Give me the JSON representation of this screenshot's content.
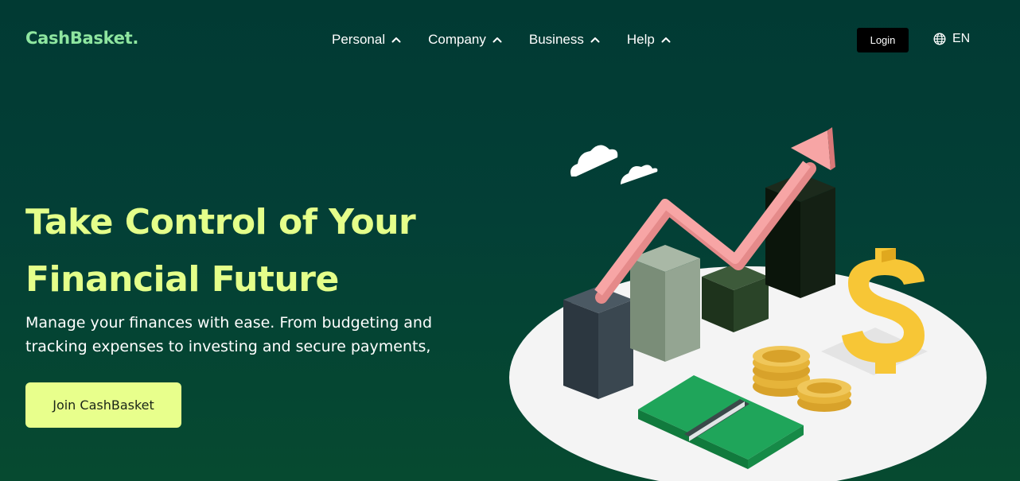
{
  "header": {
    "logo": "CashBasket.",
    "nav": [
      {
        "label": "Personal"
      },
      {
        "label": "Company"
      },
      {
        "label": "Business"
      },
      {
        "label": "Help"
      }
    ],
    "login_label": "Login",
    "language": "EN"
  },
  "hero": {
    "title_line1": "Take Control of Your",
    "title_line2": "Financial Future",
    "subtitle_line1": "Manage your finances with ease. From budgeting and",
    "subtitle_line2": "tracking expenses to investing and secure payments,",
    "cta_label": "Join CashBasket"
  },
  "colors": {
    "background": "#013a33",
    "logo": "#8ee6a0",
    "title": "#e4ff8a",
    "cta": "#e8ff8c",
    "login_bg": "#000000"
  },
  "icons": [
    "chevron-up-icon",
    "globe-icon"
  ]
}
